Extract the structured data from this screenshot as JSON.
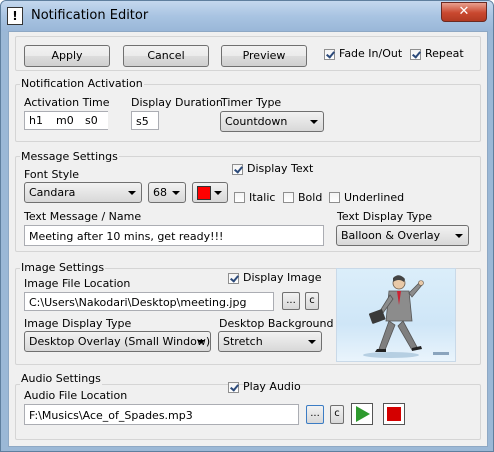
{
  "window": {
    "title": "Notification Editor",
    "icon_glyph": "!",
    "close_glyph": "✕"
  },
  "toolbar": {
    "apply": "Apply",
    "cancel": "Cancel",
    "preview": "Preview",
    "fade": {
      "label": "Fade In/Out",
      "checked": true
    },
    "repeat": {
      "label": "Repeat",
      "checked": true
    }
  },
  "activation": {
    "group_label": "Notification Activation",
    "activation_time_label": "Activation Time",
    "hours": "h1",
    "minutes": "m0",
    "seconds": "s0",
    "display_duration_label": "Display Duration",
    "display_duration": "s5",
    "timer_type_label": "Timer Type",
    "timer_type": "Countdown"
  },
  "message": {
    "group_label": "Message Settings",
    "font_style_label": "Font Style",
    "font": "Candara",
    "font_size": "68",
    "font_color": "#ff0000",
    "display_text": {
      "label": "Display Text",
      "checked": true
    },
    "italic": {
      "label": "Italic",
      "checked": false
    },
    "bold": {
      "label": "Bold",
      "checked": false
    },
    "underlined": {
      "label": "Underlined",
      "checked": false
    },
    "text_message_label": "Text Message / Name",
    "text_message": "Meeting after 10 mins, get ready!!!",
    "text_display_type_label": "Text Display Type",
    "text_display_type": "Balloon & Overlay"
  },
  "image": {
    "group_label": "Image Settings",
    "file_location_label": "Image File Location",
    "file_location": "C:\\Users\\Nakodari\\Desktop\\meeting.jpg",
    "browse": "...",
    "clear": "c",
    "display_image": {
      "label": "Display Image",
      "checked": true
    },
    "display_type_label": "Image Display Type",
    "display_type": "Desktop Overlay (Small Window)",
    "desktop_background_label": "Desktop Background",
    "desktop_background": "Stretch"
  },
  "audio": {
    "group_label": "Audio Settings",
    "file_location_label": "Audio File Location",
    "file_location": "F:\\Musics\\Ace_of_Spades.mp3",
    "browse": "...",
    "clear": "c",
    "play_audio": {
      "label": "Play Audio",
      "checked": true
    }
  },
  "colors": {
    "play": "#2e9a2e",
    "stop": "#d40000"
  }
}
